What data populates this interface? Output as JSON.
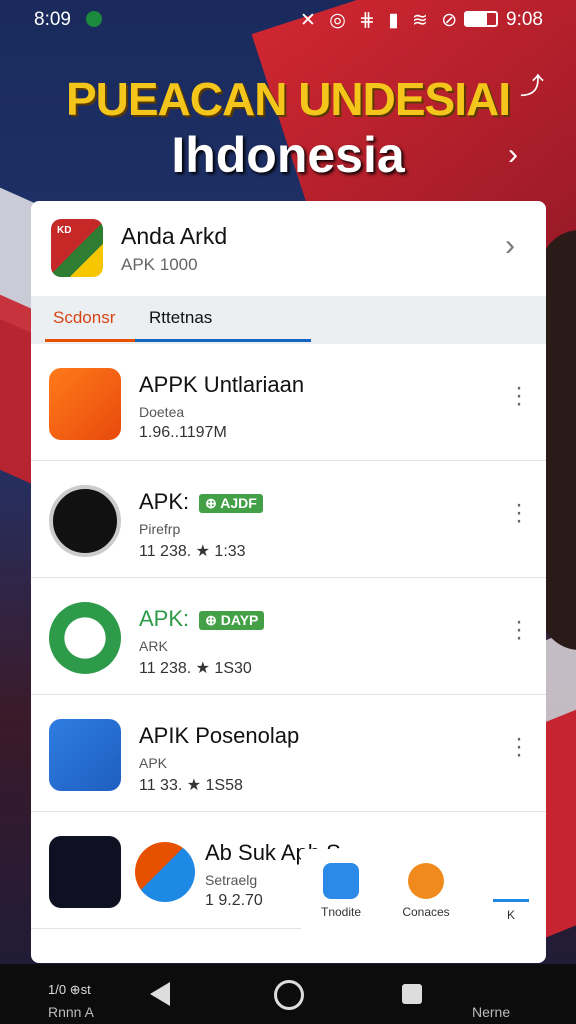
{
  "status_bar": {
    "time": "8:09",
    "icons": "✕ ◎ ⋕ ▮ ≋ ⊘",
    "clock_right": "9:08"
  },
  "hero": {
    "title_line1": "PUEACAN UNDESIAI",
    "title_line2": "Ihdonesia"
  },
  "card": {
    "title": "Anda Arkd",
    "subtitle": "APK 1000",
    "logo_text": "KD"
  },
  "tabs": {
    "tab1": "Scdonsr",
    "tab2": "Rttetnas"
  },
  "apps": [
    {
      "name": "APPK Untlariaan",
      "dev": "Doetea",
      "meta": "1.96..1197M"
    },
    {
      "name": "APK:",
      "badge": "⊕ AJDF",
      "dev": "Pirefrp",
      "meta": "11 238.  ★ 1:33"
    },
    {
      "name": "APK:",
      "badge": "⊕ DAYP",
      "dev": "ARK",
      "meta": "11 238.  ★ 1S30"
    },
    {
      "name": "APIK  Posenolap",
      "dev": "APK",
      "meta": "11 33.  ★ 1S58"
    },
    {
      "name": "Ab Suk Aph S",
      "dev": "Setraelg",
      "meta": "1 9.2.70"
    }
  ],
  "bottom_tabs": {
    "tab1": "Tnodite",
    "tab2": "Conaces",
    "tab3": "K"
  },
  "navbar": {
    "left_top": "1/0 ⊕st",
    "left_bottom": "Rnnn A",
    "right": "Nerne"
  }
}
